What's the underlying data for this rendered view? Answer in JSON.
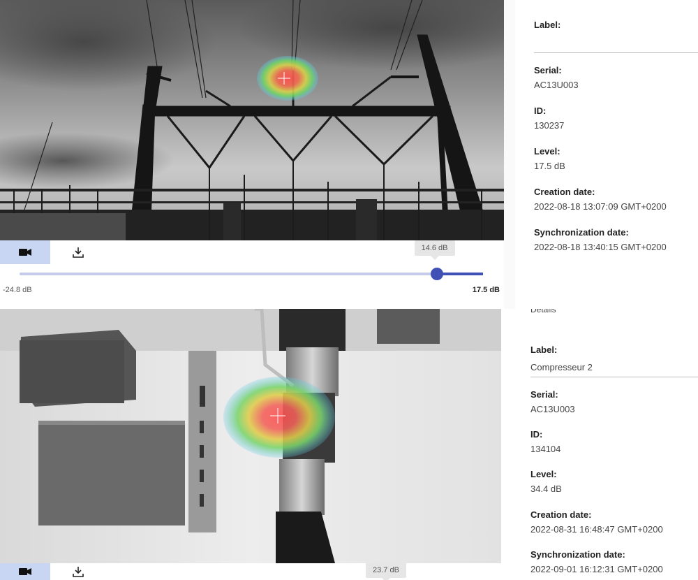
{
  "panel1": {
    "toolbar": {
      "video_icon": "video-camera-icon",
      "download_icon": "download-icon"
    },
    "slider": {
      "tooltip": "14.6 dB",
      "min_label": "-24.8 dB",
      "max_label": "17.5 dB",
      "value_fraction": 0.9
    },
    "details": {
      "label_title": "Label:",
      "label_value": "",
      "serial_title": "Serial:",
      "serial_value": "AC13U003",
      "id_title": "ID:",
      "id_value": "130237",
      "level_title": "Level:",
      "level_value": "17.5 dB",
      "creation_title": "Creation date:",
      "creation_value": "2022-08-18 13:07:09 GMT+0200",
      "sync_title": "Synchronization date:",
      "sync_value": "2022-08-18 13:40:15 GMT+0200"
    }
  },
  "panel2": {
    "toolbar": {
      "video_icon": "video-camera-icon",
      "download_icon": "download-icon"
    },
    "slider": {
      "tooltip": "23.7 dB"
    },
    "details": {
      "section_title": "Details",
      "label_title": "Label:",
      "label_value": "Compresseur 2",
      "serial_title": "Serial:",
      "serial_value": "AC13U003",
      "id_title": "ID:",
      "id_value": "134104",
      "level_title": "Level:",
      "level_value": "34.4 dB",
      "creation_title": "Creation date:",
      "creation_value": "2022-08-31 16:48:47 GMT+0200",
      "sync_title": "Synchronization date:",
      "sync_value": "2022-09-01 16:12:31 GMT+0200"
    }
  },
  "colors": {
    "accent": "#3f51b5",
    "active_tab": "#c9d6f3",
    "heat_hot": "#ff4d4d",
    "heat_cold": "#5fc8e8"
  }
}
